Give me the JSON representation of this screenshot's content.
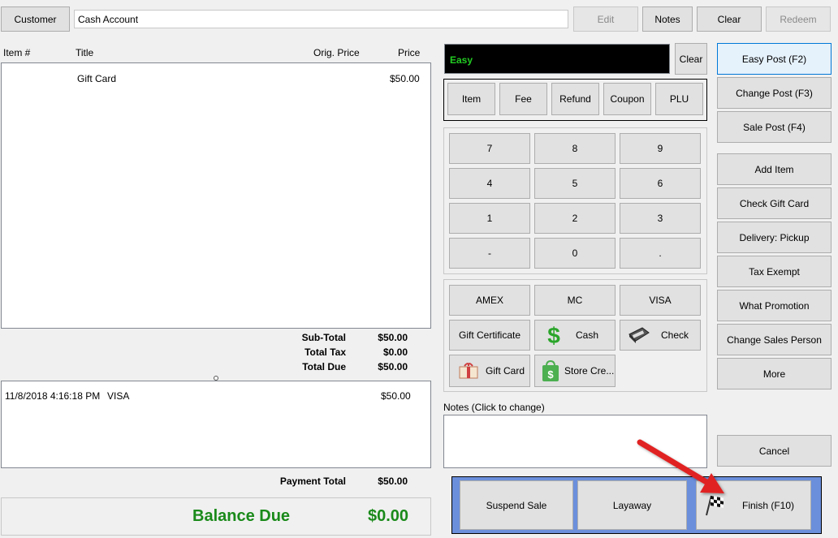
{
  "header": {
    "customer_label": "Customer",
    "customer_value": "Cash Account",
    "edit_label": "Edit",
    "notes_label": "Notes",
    "clear_label": "Clear",
    "redeem_label": "Redeem"
  },
  "items_table": {
    "columns": [
      "Item #",
      "Title",
      "Orig. Price",
      "Price"
    ],
    "rows": [
      {
        "item": "",
        "title": "Gift Card",
        "orig_price": "",
        "price": "$50.00"
      }
    ]
  },
  "totals": {
    "subtotal_label": "Sub-Total",
    "subtotal_value": "$50.00",
    "tax_label": "Total Tax",
    "tax_value": "$0.00",
    "due_label": "Total Due",
    "due_value": "$50.00"
  },
  "payments": {
    "rows": [
      {
        "date": "11/8/2018 4:16:18 PM",
        "method": "VISA",
        "amount": "$50.00"
      }
    ],
    "payment_total_label": "Payment Total",
    "payment_total_value": "$50.00"
  },
  "balance": {
    "label": "Balance Due",
    "value": "$0.00",
    "color": "#1a8a1a"
  },
  "entry": {
    "display_text": "Easy",
    "display_text_color": "#22cc22",
    "clear_label": "Clear"
  },
  "item_types": [
    "Item",
    "Fee",
    "Refund",
    "Coupon",
    "PLU"
  ],
  "keypad": [
    "7",
    "8",
    "9",
    "4",
    "5",
    "6",
    "1",
    "2",
    "3",
    "-",
    "0",
    "."
  ],
  "tenders": {
    "amex": "AMEX",
    "mc": "MC",
    "visa": "VISA",
    "gift_certificate": "Gift Certificate",
    "cash": "Cash",
    "check": "Check",
    "gift_card": "Gift Card",
    "store_credit": "Store Cre..."
  },
  "notes": {
    "label": "Notes (Click to change)",
    "value": ""
  },
  "side_buttons": [
    "Easy Post (F2)",
    "Change Post (F3)",
    "Sale Post (F4)",
    "Add Item",
    "Check Gift Card",
    "Delivery: Pickup",
    "Tax Exempt",
    "What Promotion",
    "Change Sales Person",
    "More"
  ],
  "cancel_label": "Cancel",
  "actions": {
    "suspend_label": "Suspend Sale",
    "layaway_label": "Layaway",
    "finish_label": "Finish (F10)",
    "panel_color": "#6b8fdb"
  },
  "annotation": {
    "arrow_color": "#e02020"
  }
}
